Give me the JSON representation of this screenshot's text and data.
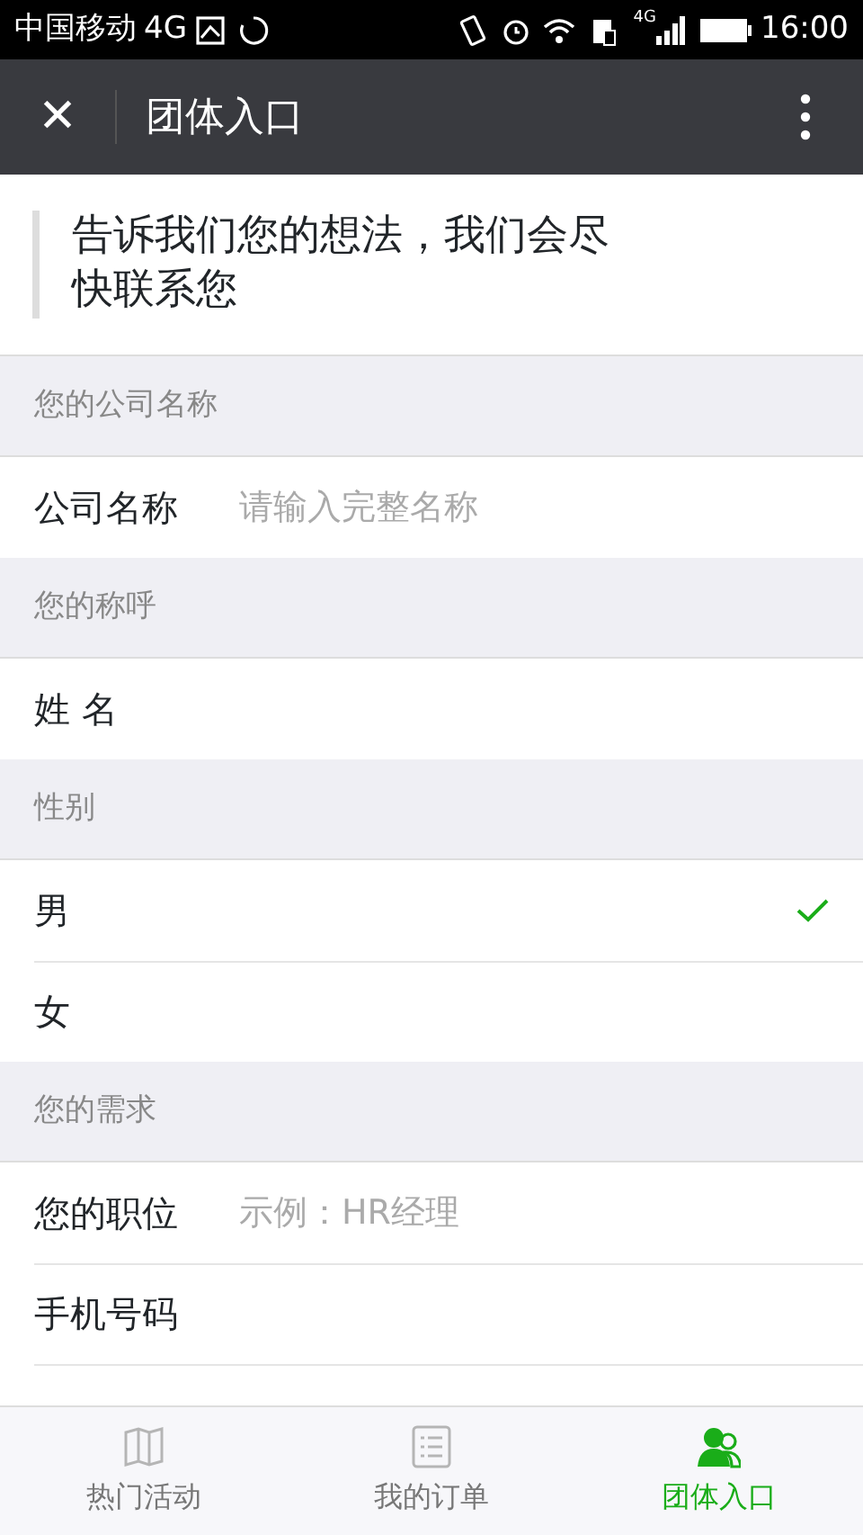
{
  "status_bar": {
    "carrier": "中国移动",
    "network": "4G",
    "signal_network": "4G",
    "time": "16:00"
  },
  "nav_bar": {
    "close": "✕",
    "title": "团体入口"
  },
  "intro": "告诉我们您的想法，我们会尽快联系您",
  "form": [
    {
      "kind": "section",
      "label": "您的公司名称"
    },
    {
      "kind": "input",
      "label": "公司名称",
      "placeholder": "请输入完整名称"
    },
    {
      "kind": "section",
      "label": "您的称呼"
    },
    {
      "kind": "input",
      "label": "姓 名"
    },
    {
      "kind": "section",
      "label": "性别"
    },
    {
      "kind": "option",
      "label": "男",
      "selected": true
    },
    {
      "kind": "option",
      "label": "女",
      "selected": false
    },
    {
      "kind": "section",
      "label": "您的需求"
    },
    {
      "kind": "input",
      "label": "您的职位",
      "placeholder": "示例：HR经理"
    },
    {
      "kind": "input",
      "label": "手机号码"
    },
    {
      "kind": "cut"
    }
  ],
  "tabs": [
    {
      "label": "热门活动",
      "kind": "map",
      "selected": false
    },
    {
      "label": "我的订单",
      "kind": "list",
      "selected": false
    },
    {
      "label": "团体入口",
      "kind": "group",
      "selected": true
    }
  ]
}
